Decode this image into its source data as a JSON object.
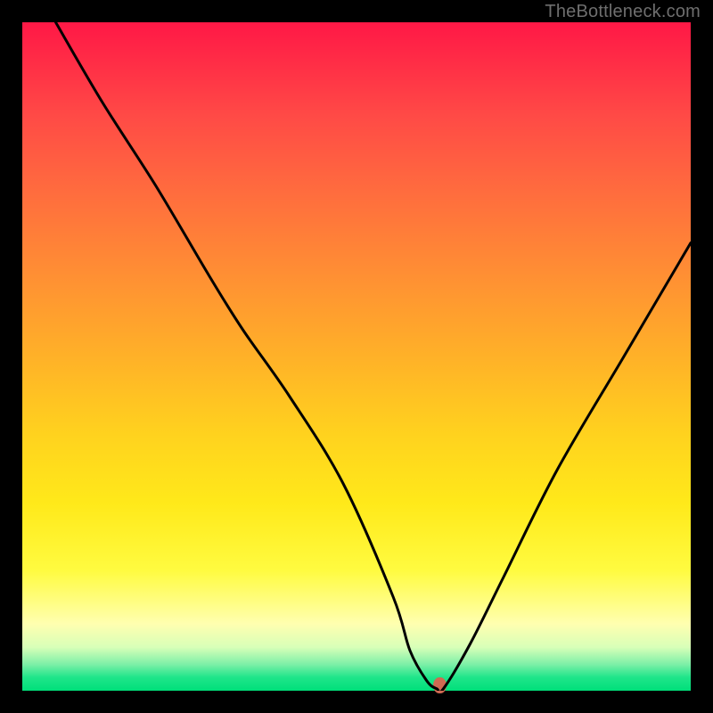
{
  "watermark": "TheBottleneck.com",
  "chart_data": {
    "type": "line",
    "title": "",
    "xlabel": "",
    "ylabel": "",
    "xlim": [
      0,
      100
    ],
    "ylim": [
      0,
      100
    ],
    "grid": false,
    "background": "rainbow-gradient-vertical red-top green-bottom",
    "series": [
      {
        "name": "bottleneck-curve",
        "color": "#000000",
        "x": [
          5,
          12,
          20,
          28,
          33,
          40,
          48,
          55.5,
          58,
          60.5,
          62,
          63,
          67,
          72,
          80,
          90,
          100
        ],
        "values": [
          100,
          88,
          75.5,
          62,
          54,
          44,
          31,
          14,
          6,
          1.5,
          0.3,
          0.3,
          7,
          17,
          33,
          50,
          67
        ]
      }
    ],
    "annotations": [
      {
        "name": "optimum-marker",
        "x": 62.5,
        "y": 0.8,
        "color": "#cf6a52"
      }
    ]
  }
}
